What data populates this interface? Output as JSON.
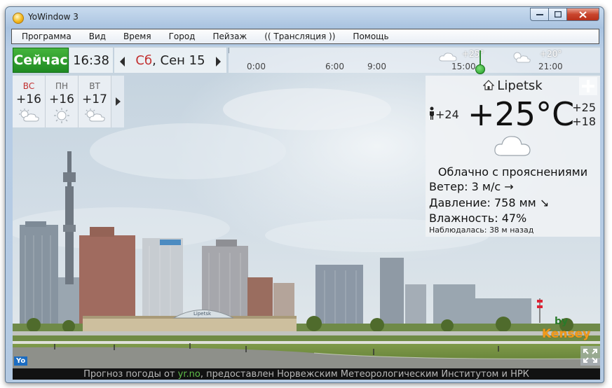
{
  "window": {
    "title": "YoWindow 3"
  },
  "menu": {
    "items": [
      "Программа",
      "Вид",
      "Время",
      "Город",
      "Пейзаж",
      "(( Трансляция ))",
      "Помощь"
    ]
  },
  "topbar": {
    "now_label": "Сейчас",
    "time": "16:38",
    "date_day": "Сб",
    "date_rest": ", Сен 15"
  },
  "timeline": {
    "labels": [
      "0:00",
      "6:00",
      "9:00",
      "15:00",
      "21:00"
    ],
    "temps": [
      "+25°",
      "+20°"
    ]
  },
  "forecast": {
    "days": [
      {
        "name": "ВС",
        "temp": "+16",
        "icon": "sun-cloud-icon",
        "weekend": true
      },
      {
        "name": "ПН",
        "temp": "+16",
        "icon": "sun-icon",
        "weekend": false
      },
      {
        "name": "ВТ",
        "temp": "+17",
        "icon": "sun-cloud-icon",
        "weekend": false
      }
    ]
  },
  "current": {
    "city": "Lipetsk",
    "feels_like": "+24",
    "temp": "+25°C",
    "high": "+25",
    "low": "+18",
    "condition": "Облачно с прояснениями",
    "wind": "Ветер:  3 м/с →",
    "pressure": "Давление:  758 мм ↘",
    "humidity": "Влажность:  47%",
    "observed": "Наблюдалась:  38 м назад"
  },
  "credits": {
    "by": "by",
    "name": "Kensey",
    "logo": "Yo",
    "footer_prefix": "Прогноз погоды от ",
    "footer_link": "yr.no",
    "footer_suffix": ", предоставлен Норвежским Метеорологическим Институтом и НРК"
  },
  "colors": {
    "accent_green": "#2a9a2e",
    "weekend_red": "#c23030",
    "kensey_orange": "#f29b1a"
  }
}
